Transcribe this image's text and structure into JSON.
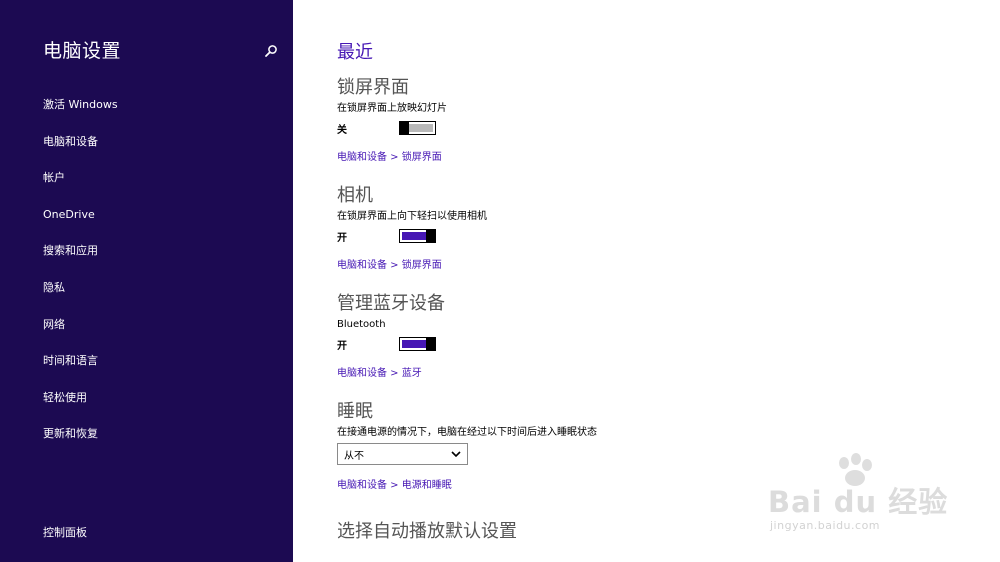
{
  "sidebar": {
    "title": "电脑设置",
    "search_icon": "search-icon",
    "items": [
      {
        "label": "激活 Windows"
      },
      {
        "label": "电脑和设备"
      },
      {
        "label": "帐户"
      },
      {
        "label": "OneDrive"
      },
      {
        "label": "搜索和应用"
      },
      {
        "label": "隐私"
      },
      {
        "label": "网络"
      },
      {
        "label": "时间和语言"
      },
      {
        "label": "轻松使用"
      },
      {
        "label": "更新和恢复"
      }
    ],
    "control_panel": "控制面板"
  },
  "main": {
    "title": "最近",
    "lock_screen": {
      "title": "锁屏界面",
      "desc": "在锁屏界面上放映幻灯片",
      "state": "关",
      "toggle_on": false,
      "link": "电脑和设备 > 锁屏界面"
    },
    "camera": {
      "title": "相机",
      "desc": "在锁屏界面上向下轻扫以使用相机",
      "state": "开",
      "toggle_on": true,
      "link": "电脑和设备 > 锁屏界面"
    },
    "bluetooth": {
      "title": "管理蓝牙设备",
      "desc": "Bluetooth",
      "state": "开",
      "toggle_on": true,
      "link": "电脑和设备 > 蓝牙"
    },
    "sleep": {
      "title": "睡眠",
      "desc": "在接通电源的情况下，电脑在经过以下时间后进入睡眠状态",
      "selected": "从不",
      "link": "电脑和设备 > 电源和睡眠"
    },
    "autoplay": {
      "title": "选择自动播放默认设置"
    }
  },
  "watermark": {
    "main": "Bai du 经验",
    "sub": "jingyan.baidu.com"
  },
  "colors": {
    "sidebar_bg": "#1c0a52",
    "accent": "#4617b4",
    "toggle_off": "#b9b9b9"
  }
}
